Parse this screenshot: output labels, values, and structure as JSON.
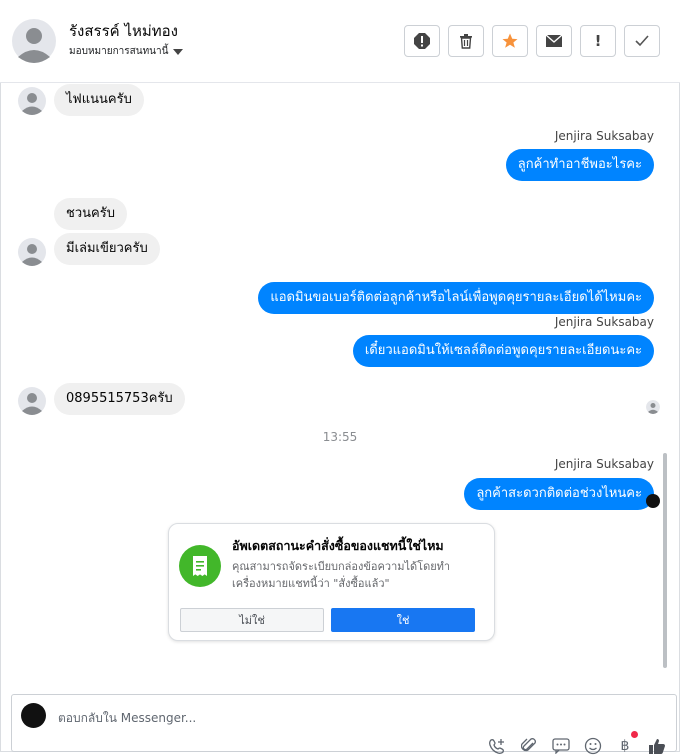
{
  "header": {
    "contact_name": "รังสรรค์ ไหม่ทอง",
    "assign_label": "มอบหมายการสนทนานี้",
    "actions": [
      {
        "name": "spam-icon",
        "label": "!"
      },
      {
        "name": "trash-icon",
        "label": ""
      },
      {
        "name": "star-icon",
        "label": "★"
      },
      {
        "name": "mail-icon",
        "label": "✉"
      },
      {
        "name": "exclamation-icon",
        "label": "!"
      },
      {
        "name": "checkmark-icon",
        "label": "✓"
      }
    ]
  },
  "messages": [
    {
      "dir": "in",
      "text": "ไฟแนนครับ"
    },
    {
      "dir": "out",
      "sender": "Jenjira Suksabay",
      "text": "ลูกค้าทำอาชีพอะไรคะ"
    },
    {
      "dir": "in",
      "text": "ชวนครับ"
    },
    {
      "dir": "in",
      "text": "มีเล่มเขียวครับ"
    },
    {
      "dir": "out",
      "text": "แอดมินขอเบอร์ติดต่อลูกค้าหรือไลน์เพื่อพูดคุยรายละเอียดได้ไหมคะ"
    },
    {
      "dir": "out",
      "sender": "Jenjira Suksabay",
      "text": "เดี๋ยวแอดมินให้เซลล์ติดต่อพูดคุยรายละเอียดนะคะ"
    },
    {
      "dir": "in",
      "text": "0895515753ครับ"
    },
    {
      "dir": "out",
      "sender": "Jenjira Suksabay",
      "text": "ลูกค้าสะดวกติดต่อช่วงไหนคะ"
    }
  ],
  "timestamp": "13:55",
  "card": {
    "title": "อัพเดตสถานะคำสั่งซื้อของแชทนี้ใช่ไหม",
    "body": "คุณสามารถจัดระเบียบกล่องข้อความได้โดยทำเครื่องหมายแชทนี้ว่า \"สั่งซื้อแล้ว\"",
    "no_label": "ไม่ใช่",
    "yes_label": "ใช่"
  },
  "composer": {
    "placeholder": "ตอบกลับใน Messenger...",
    "tools": [
      "add-call-icon",
      "attachment-icon",
      "saved-replies-icon",
      "emoji-icon",
      "payment-icon",
      "like-icon"
    ]
  },
  "colors": {
    "outgoing_bubble": "#0084ff",
    "incoming_bubble": "#f0f0f0",
    "card_accent": "#42b72a",
    "primary_button": "#1877f2"
  }
}
